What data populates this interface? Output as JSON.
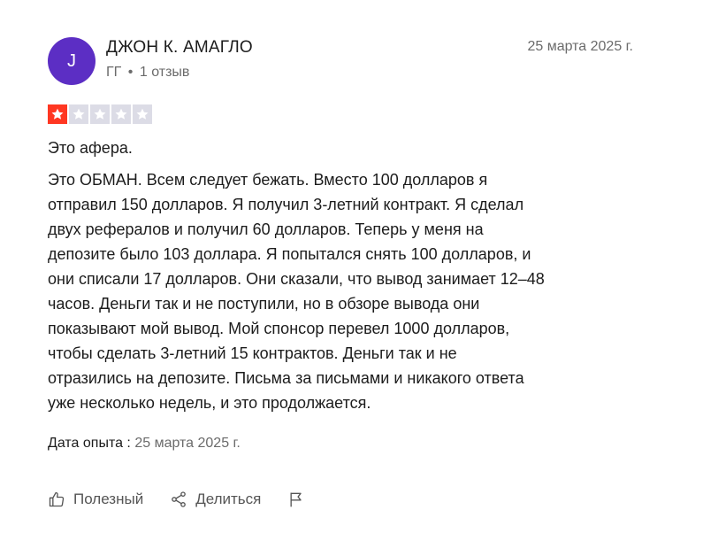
{
  "review": {
    "avatar_letter": "J",
    "author_name": "ДЖОН К. АМАГЛО",
    "author_country": "ГГ",
    "separator": "•",
    "author_reviews": "1 отзыв",
    "date": "25 марта 2025 г.",
    "rating": 1,
    "rating_max": 5,
    "title": "Это афера.",
    "body": "Это ОБМАН. Всем следует бежать. Вместо 100 долларов я\nотправил 150 долларов. Я получил 3-летний контракт. Я сделал\nдвух рефералов и получил 60 долларов. Теперь у меня на\nдепозите было 103 доллара. Я попытался снять 100 долларов, и\nони списали 17 долларов. Они сказали, что вывод занимает 12–48\nчасов. Деньги так и не поступили, но в обзоре вывода они\nпоказывают мой вывод. Мой спонсор перевел 1000 долларов,\nчтобы сделать 3-летний 15 контрактов. Деньги так и не\nотразились на депозите. Письма за письмами и никакого ответа\nуже несколько недель, и это продолжается.",
    "experience_label": "Дата опыта :",
    "experience_date": "25 марта 2025 г."
  },
  "actions": {
    "useful_label": "Полезный",
    "useful_icon": "thumbs-up-icon",
    "share_label": "Делиться",
    "share_icon": "share-icon",
    "report_icon": "flag-icon"
  },
  "colors": {
    "avatar_bg": "#5c2ec4",
    "star_filled_bg": "#ff3722",
    "star_empty_bg": "#dcdce6",
    "muted_text": "#6b6b6b"
  }
}
